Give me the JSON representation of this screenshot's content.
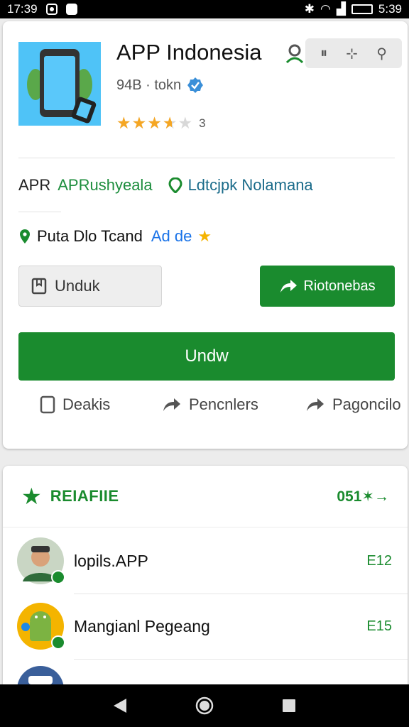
{
  "status_bar": {
    "time_left": "17:39",
    "time_right": "5:39"
  },
  "app": {
    "title": "APP Indonesia",
    "meta": "94B · tokn",
    "rating_value": 3.6,
    "rating_count": "3"
  },
  "info": {
    "line_a_dark": "APR",
    "line_a_green": "APRushyeala",
    "line_a_loc": "Ldtcjpk Nolamana",
    "line_b_dark": "Puta Dlo Tcand",
    "line_b_blue": "Ad de"
  },
  "buttons": {
    "download_outline": "Unduk",
    "share_green": "Riotonebas",
    "install": "Undw"
  },
  "actions": [
    {
      "label": "Deakis"
    },
    {
      "label": "Pencnlers"
    },
    {
      "label": "Pagoncilo"
    }
  ],
  "related": {
    "title": "REIAFIIE",
    "more": "051"
  },
  "list": [
    {
      "name": "lopils.APP",
      "value": "E12"
    },
    {
      "name": "Mangianl Pegeang",
      "value": "E15"
    },
    {
      "name": "",
      "value": ""
    }
  ],
  "colors": {
    "brand_green": "#1a8b2e",
    "link_blue": "#1a73e8",
    "star_yellow": "#f5a623",
    "icon_bg": "#4fc3f7"
  }
}
